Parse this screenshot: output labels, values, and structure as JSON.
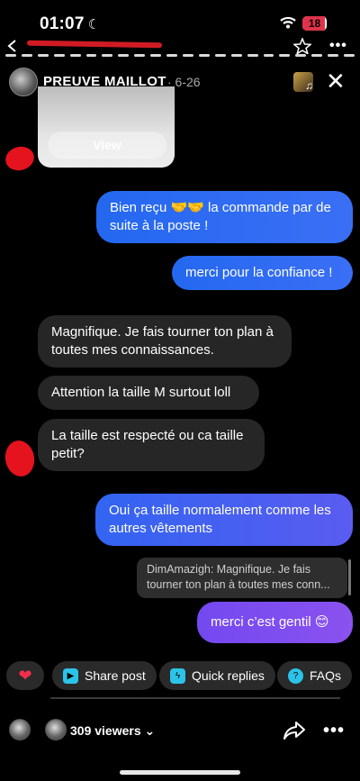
{
  "status": {
    "time": "01:07",
    "battery": "18"
  },
  "story": {
    "name": "PREUVE MAILLOT",
    "date": "· 6-26",
    "view_label": "View"
  },
  "messages": [
    {
      "id": "m1",
      "from": "me",
      "text": "Bien reçu 🤝🤝 la commande par de suite à la poste !"
    },
    {
      "id": "m2",
      "from": "me",
      "text": "merci pour la confiance !"
    },
    {
      "id": "m3",
      "from": "them",
      "text": "Magnifique.  Je fais tourner ton plan à toutes mes connaissances."
    },
    {
      "id": "m4",
      "from": "them",
      "text": "Attention  la taille M surtout loll"
    },
    {
      "id": "m5",
      "from": "them",
      "text": "La taille est respecté ou ca taille petit?"
    },
    {
      "id": "m6",
      "from": "me",
      "text": "Oui ça taille normalement comme les autres vêtements"
    },
    {
      "id": "m7",
      "from": "me",
      "text": "merci c’est gentil 😊"
    }
  ],
  "reply_quote": "DimAmazigh: Magnifique.  Je fais tourner ton plan à toutes mes conn...",
  "actions": {
    "share_post": "Share post",
    "quick_replies": "Quick replies",
    "faqs": "FAQs"
  },
  "footer": {
    "viewers": "309 viewers"
  },
  "colors": {
    "sent_bubble": "#2468f0",
    "last_sent_bubble": "#7a4ef2",
    "received_bubble": "#262626",
    "heart": "#f0304a"
  }
}
